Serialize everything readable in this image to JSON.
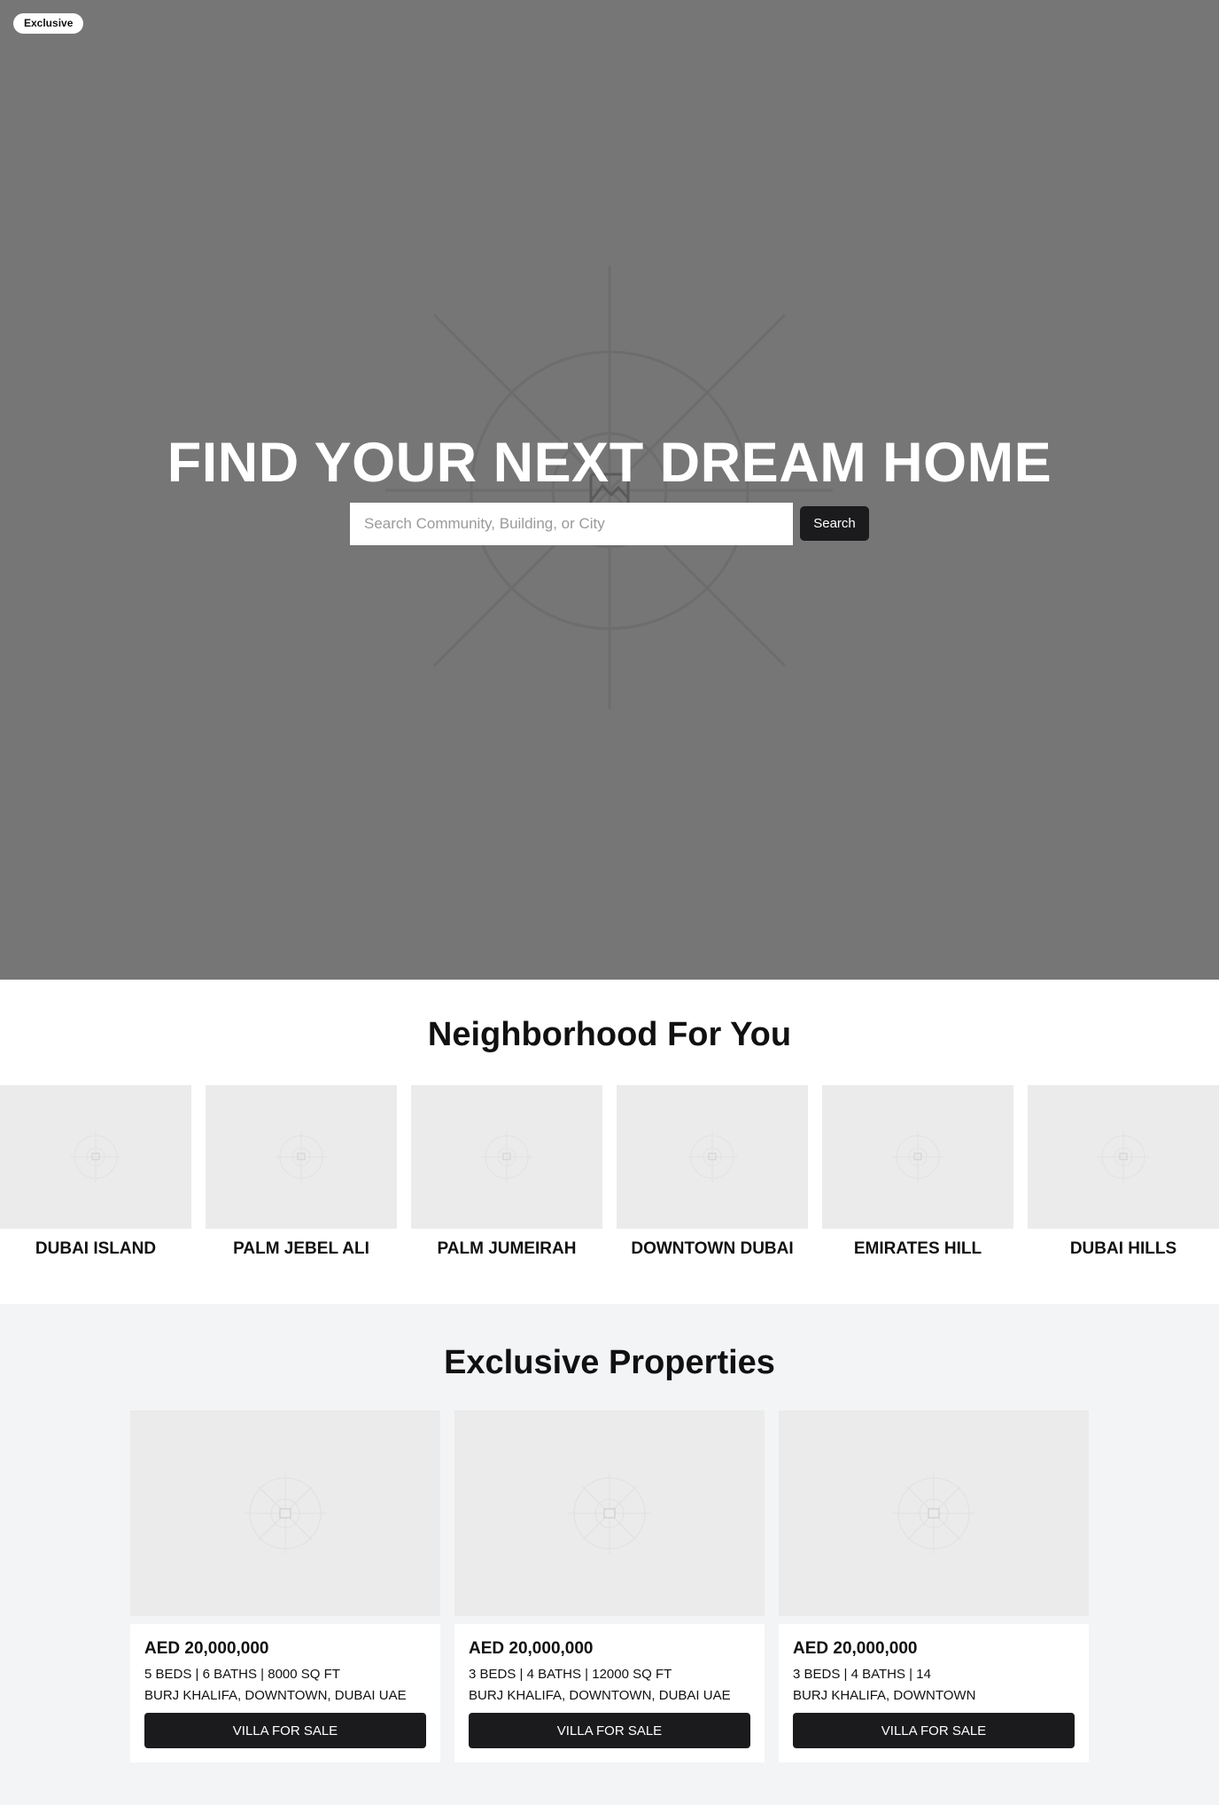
{
  "hero": {
    "badge": "Exclusive",
    "title": "FIND YOUR NEXT DREAM HOME",
    "search_placeholder": "Search Community, Building, or City",
    "search_button": "Search",
    "background_color": "#767676"
  },
  "neighborhoods": {
    "title": "Neighborhood For You",
    "items": [
      {
        "label": "DUBAI ISLAND"
      },
      {
        "label": "PALM JEBEL ALI"
      },
      {
        "label": "PALM JUMEIRAH"
      },
      {
        "label": "DOWNTOWN DUBAI"
      },
      {
        "label": "EMIRATES HILL"
      },
      {
        "label": "DUBAI HILLS"
      }
    ]
  },
  "exclusive": {
    "title": "Exclusive Properties",
    "properties": [
      {
        "price": "AED 20,000,000",
        "specs": "5 BEDS | 6 BATHS | 8000 SQ FT",
        "address": "BURJ KHALIFA, DOWNTOWN, DUBAI UAE",
        "button": "VILLA FOR SALE"
      },
      {
        "price": "AED 20,000,000",
        "specs": "3 BEDS | 4 BATHS | 12000 SQ FT",
        "address": "BURJ KHALIFA, DOWNTOWN, DUBAI UAE",
        "button": "VILLA FOR SALE"
      },
      {
        "price": "AED 20,000,000",
        "specs": "3 BEDS | 4 BATHS | 14",
        "address": "BURJ KHALIFA, DOWNTOWN",
        "button": "VILLA FOR SALE"
      }
    ]
  },
  "icons": {
    "image_placeholder": "image-placeholder-icon"
  },
  "colors": {
    "primary_button": "#1b1b1d",
    "section_bg": "#f3f4f6",
    "placeholder_bg": "#ebebeb"
  }
}
